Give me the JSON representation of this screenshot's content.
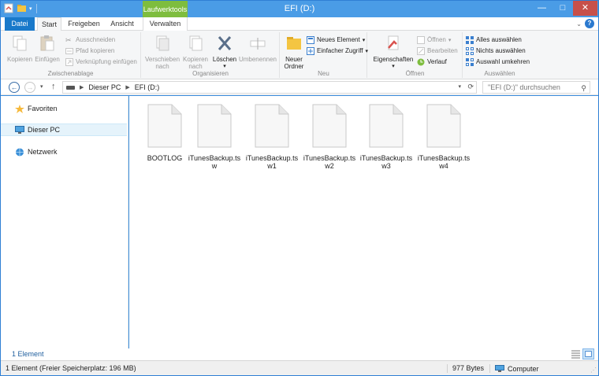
{
  "window": {
    "title": "EFI (D:)",
    "contextual_tab": "Laufwerktools",
    "controls": {
      "minimize": "—",
      "maximize": "□",
      "close": "✕"
    }
  },
  "ribbon_tabs": [
    {
      "label": "Datei"
    },
    {
      "label": "Start"
    },
    {
      "label": "Freigeben"
    },
    {
      "label": "Ansicht"
    },
    {
      "label": "Verwalten"
    }
  ],
  "ribbon": {
    "clipboard": {
      "label": "Zwischenablage",
      "copy": "Kopieren",
      "paste": "Einfügen",
      "cut": "Ausschneiden",
      "copy_path": "Pfad kopieren",
      "paste_shortcut": "Verknüpfung einfügen"
    },
    "organize": {
      "label": "Organisieren",
      "move_to_1": "Verschieben",
      "move_to_2": "nach",
      "copy_to_1": "Kopieren",
      "copy_to_2": "nach",
      "delete": "Löschen",
      "rename": "Umbenennen"
    },
    "new": {
      "label": "Neu",
      "new_folder_1": "Neuer",
      "new_folder_2": "Ordner",
      "new_item": "Neues Element",
      "easy_access": "Einfacher Zugriff"
    },
    "open": {
      "label": "Öffnen",
      "properties": "Eigenschaften",
      "open": "Öffnen",
      "edit": "Bearbeiten",
      "history": "Verlauf"
    },
    "select": {
      "label": "Auswählen",
      "select_all": "Alles auswählen",
      "select_none": "Nichts auswählen",
      "invert": "Auswahl umkehren"
    }
  },
  "address": {
    "crumbs": [
      "Dieser PC",
      "EFI (D:)"
    ],
    "search_placeholder": "\"EFI (D:)\" durchsuchen"
  },
  "nav_pane": [
    {
      "label": "Favoriten",
      "icon": "star-icon"
    },
    {
      "label": "Dieser PC",
      "icon": "computer-icon",
      "selected": true
    },
    {
      "label": "Netzwerk",
      "icon": "network-icon"
    }
  ],
  "files": [
    {
      "name": "BOOTLOG"
    },
    {
      "name": "iTunesBackup.tsw"
    },
    {
      "name": "iTunesBackup.tsw1"
    },
    {
      "name": "iTunesBackup.tsw2"
    },
    {
      "name": "iTunesBackup.tsw3"
    },
    {
      "name": "iTunesBackup.tsw4"
    }
  ],
  "status": {
    "item_count": "1 Element",
    "free_space": "1 Element (Freier Speicherplatz: 196 MB)",
    "size": "977 Bytes",
    "location": "Computer"
  },
  "colors": {
    "accent": "#1979ca",
    "contextual": "#7ebd3e",
    "close": "#c7504a"
  }
}
